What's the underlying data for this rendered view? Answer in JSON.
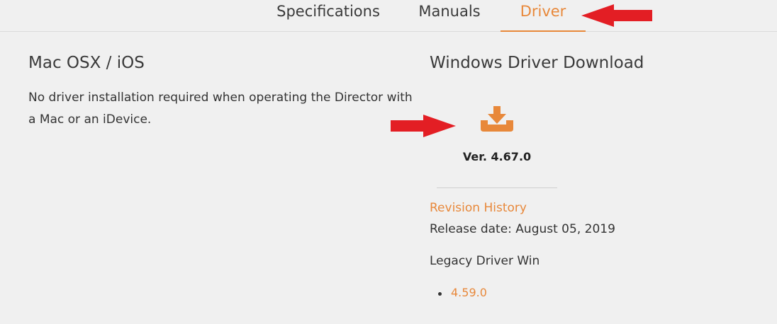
{
  "tabs": {
    "specifications": "Specifications",
    "manuals": "Manuals",
    "driver": "Driver"
  },
  "mac": {
    "title": "Mac OSX / iOS",
    "description": "No driver installation required when operating the Director with a Mac or an iDevice."
  },
  "windows": {
    "title": "Windows Driver Download",
    "download_icon": "download-tray-icon",
    "version": "Ver. 4.67.0",
    "revision_history": "Revision History",
    "release_date": "Release date: August 05, 2019",
    "legacy_title": "Legacy Driver Win",
    "legacy_versions": [
      "4.59.0"
    ]
  },
  "colors": {
    "accent": "#e8883a",
    "annotation_arrow": "#e31e24"
  }
}
